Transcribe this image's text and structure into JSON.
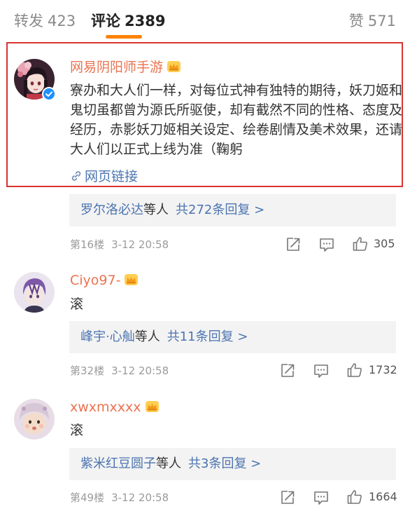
{
  "tabs": {
    "repost_label": "转发",
    "repost_count": "423",
    "comment_label": "评论",
    "comment_count": "2389",
    "like_label": "赞",
    "like_count": "571"
  },
  "colors": {
    "accent_orange": "#ff8200",
    "username": "#eb7350",
    "reply_link": "#4c74b0",
    "highlight_border": "#d9332f",
    "verified_blue": "#1e90ff"
  },
  "comments": [
    {
      "username": "网易阴阳师手游",
      "vip_icon": "vip-crown-icon",
      "verified_icon": "verified-badge-icon",
      "body": "寮办和大人们一样，对每位式神有独特的期待，妖刀姬和鬼切虽都曾为源氏所驱使，却有截然不同的性格、态度及经历，赤影妖刀姬相关设定、绘卷剧情及美术效果，还请大人们以正式上线为准（鞠躬",
      "link_icon": "link-icon",
      "link_text": "网页链接",
      "reply_names": "罗尔洛必达",
      "reply_suffix": "等人",
      "reply_count": "共272条回复 >",
      "floor": "第16楼",
      "time": "3-12 20:58",
      "likes": "305"
    },
    {
      "username": "Ciyo97-",
      "vip_icon": "vip-crown-icon",
      "body": "滚",
      "reply_names": "峰宇·心舢",
      "reply_suffix": "等人",
      "reply_count": "共11条回复 >",
      "floor": "第32楼",
      "time": "3-12 20:58",
      "likes": "1732"
    },
    {
      "username": "xwxmxxxx",
      "vip_icon": "vip-crown-icon",
      "body": "滚",
      "reply_names": "紫米红豆圆子",
      "reply_suffix": "等人",
      "reply_count": "共3条回复 >",
      "floor": "第49楼",
      "time": "3-12 20:58",
      "likes": "1664"
    }
  ]
}
